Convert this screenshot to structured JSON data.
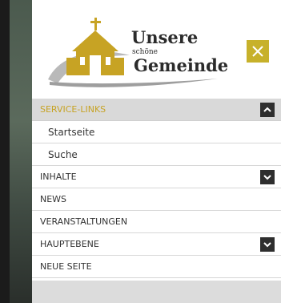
{
  "logo": {
    "line1": "Unsere",
    "line2": "schöne",
    "line3": "Gemeinde"
  },
  "menu": {
    "service_links": "SERVICE-LINKS",
    "startseite": "Startseite",
    "suche": "Suche",
    "inhalte": "INHALTE",
    "news": "NEWS",
    "veranstaltungen": "VERANSTALTUNGEN",
    "hauptebene": "HAUPTEBENE",
    "neue_seite": "NEUE SEITE"
  },
  "colors": {
    "accent": "#c7b12a",
    "active_text": "#c7a324",
    "active_bg": "#d9d9d9",
    "toggle_bg": "#2e2e2e"
  },
  "icons": {
    "close": "close-icon",
    "chevron_up": "chevron-up-icon",
    "chevron_down": "chevron-down-icon"
  }
}
